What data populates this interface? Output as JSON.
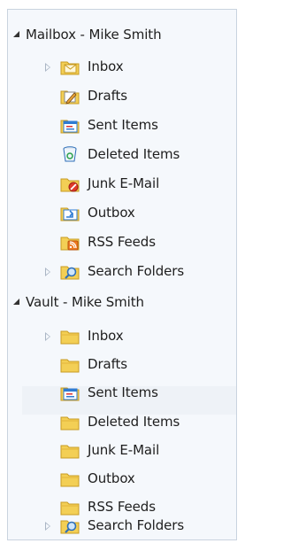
{
  "groups": [
    {
      "title": "Mailbox - Mike Smith",
      "folders": [
        {
          "label": "Inbox",
          "icon": "inbox-folder-icon"
        },
        {
          "label": "Drafts",
          "icon": "drafts-folder-icon"
        },
        {
          "label": "Sent Items",
          "icon": "sent-items-folder-icon"
        },
        {
          "label": "Deleted Items",
          "icon": "recycle-bin-icon"
        },
        {
          "label": "Junk E-Mail",
          "icon": "junk-folder-icon"
        },
        {
          "label": "Outbox",
          "icon": "outbox-folder-icon"
        },
        {
          "label": "RSS Feeds",
          "icon": "rss-folder-icon"
        },
        {
          "label": "Search Folders",
          "icon": "search-folder-icon"
        }
      ]
    },
    {
      "title": "Vault - Mike Smith",
      "folders": [
        {
          "label": "Inbox",
          "icon": "folder-icon"
        },
        {
          "label": "Drafts",
          "icon": "folder-icon"
        },
        {
          "label": "Sent Items",
          "icon": "sent-items-folder-icon"
        },
        {
          "label": "Deleted Items",
          "icon": "folder-icon"
        },
        {
          "label": "Junk E-Mail",
          "icon": "folder-icon"
        },
        {
          "label": "Outbox",
          "icon": "folder-icon"
        },
        {
          "label": "RSS Feeds",
          "icon": "folder-icon"
        },
        {
          "label": "Search Folders",
          "icon": "search-folder-icon"
        }
      ]
    }
  ],
  "colors": {
    "folder_yellow": "#f3cf55",
    "folder_dark": "#d9a520",
    "accent_blue": "#2f7bd3",
    "rss_orange": "#f07a20",
    "junk_red": "#e03a2a"
  }
}
